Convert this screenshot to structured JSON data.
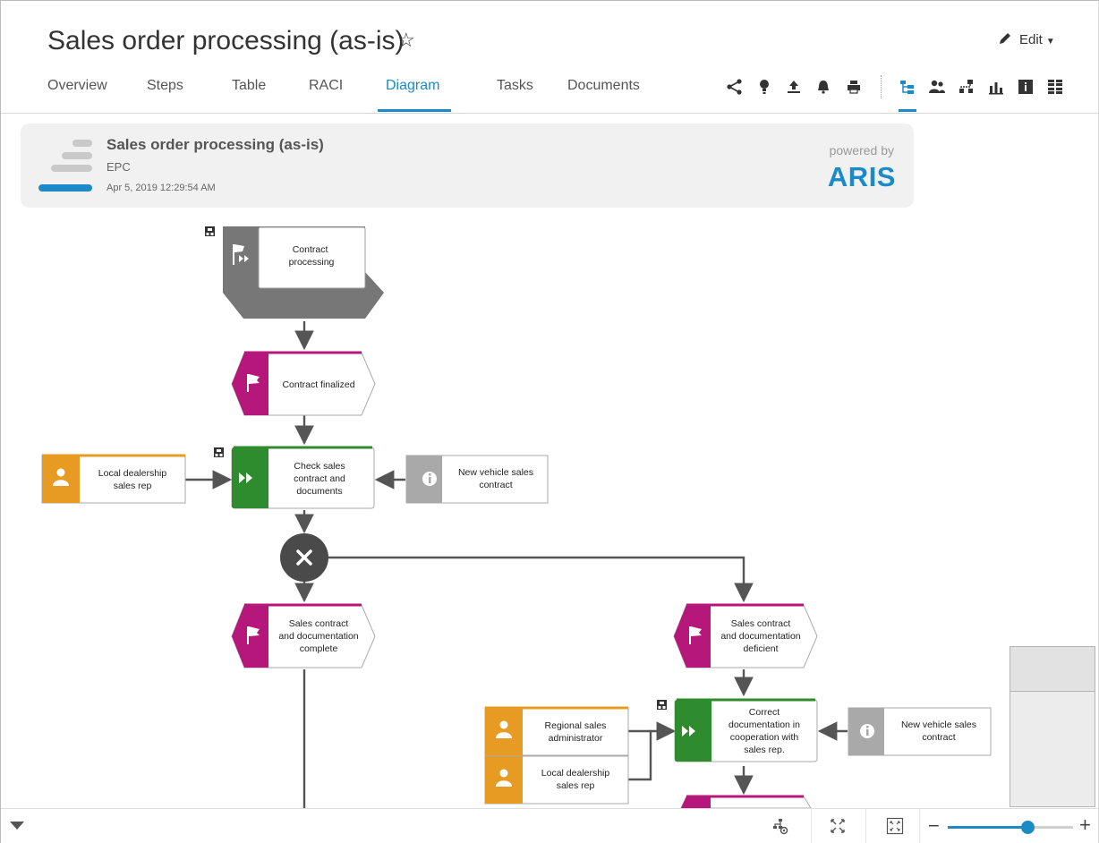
{
  "header": {
    "title": "Sales order processing (as-is)",
    "edit_label": "Edit",
    "tabs": [
      {
        "label": "Overview",
        "active": false
      },
      {
        "label": "Steps",
        "active": false
      },
      {
        "label": "Table",
        "active": false
      },
      {
        "label": "RACI",
        "active": false
      },
      {
        "label": "Diagram",
        "active": true
      },
      {
        "label": "Tasks",
        "active": false
      },
      {
        "label": "Documents",
        "active": false
      }
    ],
    "toolbar_icons": [
      "share-icon",
      "lightbulb-icon",
      "upload-icon",
      "notification-bell-icon",
      "print-icon",
      "tree-structure-icon",
      "users-icon",
      "hierarchy-icon",
      "bar-chart-icon",
      "info-icon",
      "grid-view-icon"
    ]
  },
  "info_card": {
    "title": "Sales order processing (as-is)",
    "type": "EPC",
    "date": "Apr 5, 2019 12:29:54 AM",
    "powered_by": "powered by",
    "brand": "ARIS"
  },
  "diagram": {
    "process_interface": "Contract\nprocessing",
    "events": [
      "Contract finalized",
      "Sales contract\nand documentation\ncomplete",
      "Sales contract\nand documentation\ndeficient"
    ],
    "functions": [
      "Check sales\ncontract and\ndocuments",
      "Correct\ndocumentation in\ncooperation with\nsales rep."
    ],
    "roles": [
      "Local dealership\nsales rep",
      "Regional sales\nadministrator",
      "Local dealership\nsales rep"
    ],
    "information_carriers": [
      "New vehicle sales\ncontract",
      "New vehicle sales\ncontract"
    ],
    "connector": "XOR",
    "colors": {
      "event": "#b5177a",
      "function": "#2e8b2e",
      "role": "#e89b23",
      "info": "#a9a9a9",
      "interface": "#777777",
      "connector": "#4a4a4a"
    }
  },
  "zoom": {
    "level": 0.64
  },
  "bottom_bar_icons": [
    "layout-icon",
    "fit-to-screen-icon",
    "fullscreen-icon"
  ]
}
